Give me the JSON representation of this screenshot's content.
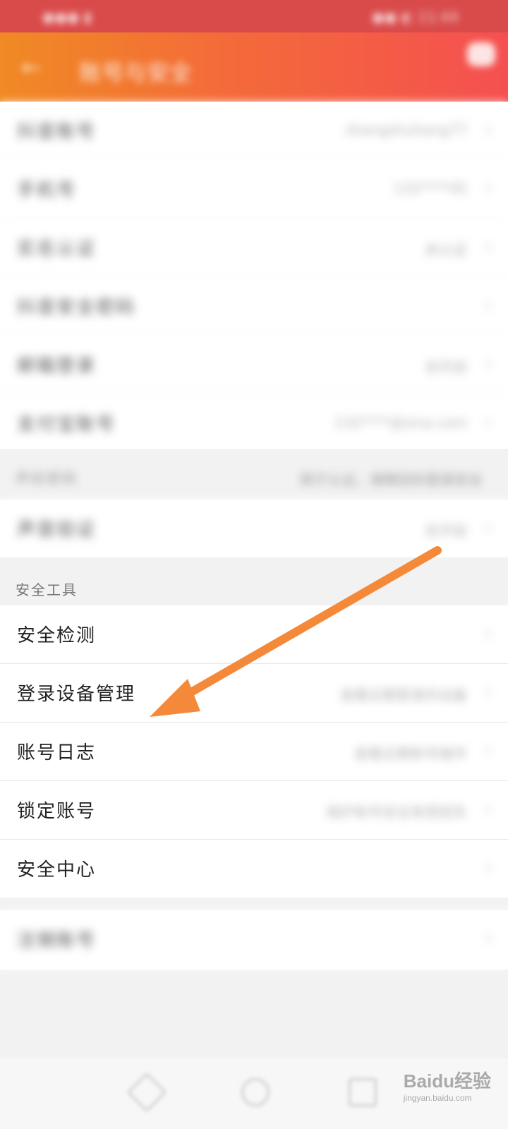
{
  "status_bar": {
    "left": "●●● ▮",
    "right": "●● ◐ 11:44"
  },
  "header": {
    "title": "账号与安全"
  },
  "account_rows": [
    {
      "label": "抖音账号",
      "value": "zhangshuhang77"
    },
    {
      "label": "手机号",
      "value": "132****45"
    },
    {
      "label": "实名认证",
      "value": "未认证"
    },
    {
      "label": "抖音安全密码",
      "value": ""
    },
    {
      "label": "邮箱登录",
      "value": "去开启"
    },
    {
      "label": "支付宝账号",
      "value": "132****@sina.com"
    }
  ],
  "voice_section": {
    "title": "声纹密码",
    "note": "用于认证，保障您的登录安全"
  },
  "voice_row": {
    "label": "声音验证",
    "value": "去开启"
  },
  "tools_section": {
    "title": "安全工具"
  },
  "tool_rows": [
    {
      "label": "安全检测",
      "value": ""
    },
    {
      "label": "登录设备管理",
      "value": "查看近期登录的设备"
    },
    {
      "label": "账号日志",
      "value": "查看近期账号操作"
    },
    {
      "label": "锁定账号",
      "value": "保护账号安全免受损失"
    },
    {
      "label": "安全中心",
      "value": ""
    }
  ],
  "cancel_row": {
    "label": "注销账号"
  },
  "chevron": "›",
  "watermark": {
    "brand": "Baidu经验",
    "url": "jingyan.baidu.com"
  },
  "colors": {
    "header_start": "#f08a24",
    "header_end": "#f45050",
    "arrow": "#f5893a"
  }
}
